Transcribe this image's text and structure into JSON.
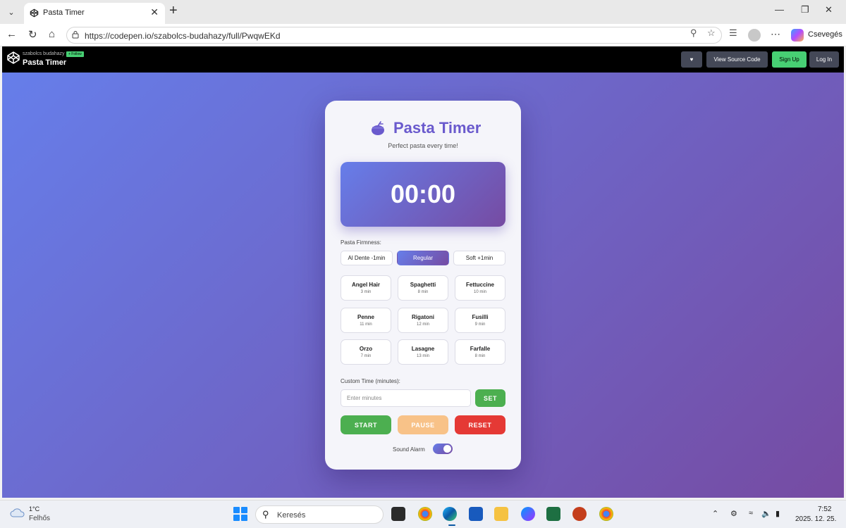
{
  "browser": {
    "tab_title": "Pasta Timer",
    "url": "https://codepen.io/szabolcs-budahazy/full/PwqwEKd",
    "copilot_label": "Csevegés"
  },
  "codepen": {
    "author": "szabolcs budahazy",
    "follow_label": "+ Follow",
    "pen_title": "Pasta Timer",
    "view_source_label": "View Source Code",
    "signup_label": "Sign Up",
    "login_label": "Log In"
  },
  "app": {
    "title": "Pasta Timer",
    "subtitle": "Perfect pasta every time!",
    "time_display": "00:00",
    "firmness_label": "Pasta Firmness:",
    "firmness_options": [
      {
        "label": "Al Dente -1min",
        "active": false
      },
      {
        "label": "Regular",
        "active": true
      },
      {
        "label": "Soft +1min",
        "active": false
      }
    ],
    "pastas": [
      {
        "name": "Angel Hair",
        "time": "3 min"
      },
      {
        "name": "Spaghetti",
        "time": "8 min"
      },
      {
        "name": "Fettuccine",
        "time": "10 min"
      },
      {
        "name": "Penne",
        "time": "11 min"
      },
      {
        "name": "Rigatoni",
        "time": "12 min"
      },
      {
        "name": "Fusilli",
        "time": "9 min"
      },
      {
        "name": "Orzo",
        "time": "7 min"
      },
      {
        "name": "Lasagne",
        "time": "13 min"
      },
      {
        "name": "Farfalle",
        "time": "8 min"
      }
    ],
    "custom_label": "Custom Time (minutes):",
    "custom_placeholder": "Enter minutes",
    "set_label": "SET",
    "start_label": "START",
    "pause_label": "PAUSE",
    "reset_label": "RESET",
    "sound_label": "Sound Alarm",
    "sound_on": true
  },
  "colors": {
    "accent": "#667eea",
    "accent_dark": "#764ba2",
    "title": "#6a5acd",
    "start": "#4caf50",
    "pause": "#f8c288",
    "reset": "#e53935"
  },
  "taskbar": {
    "temperature": "1°C",
    "weather": "Felhős",
    "search_label": "Keresés",
    "time": "7:52",
    "date": "2025. 12. 25."
  }
}
